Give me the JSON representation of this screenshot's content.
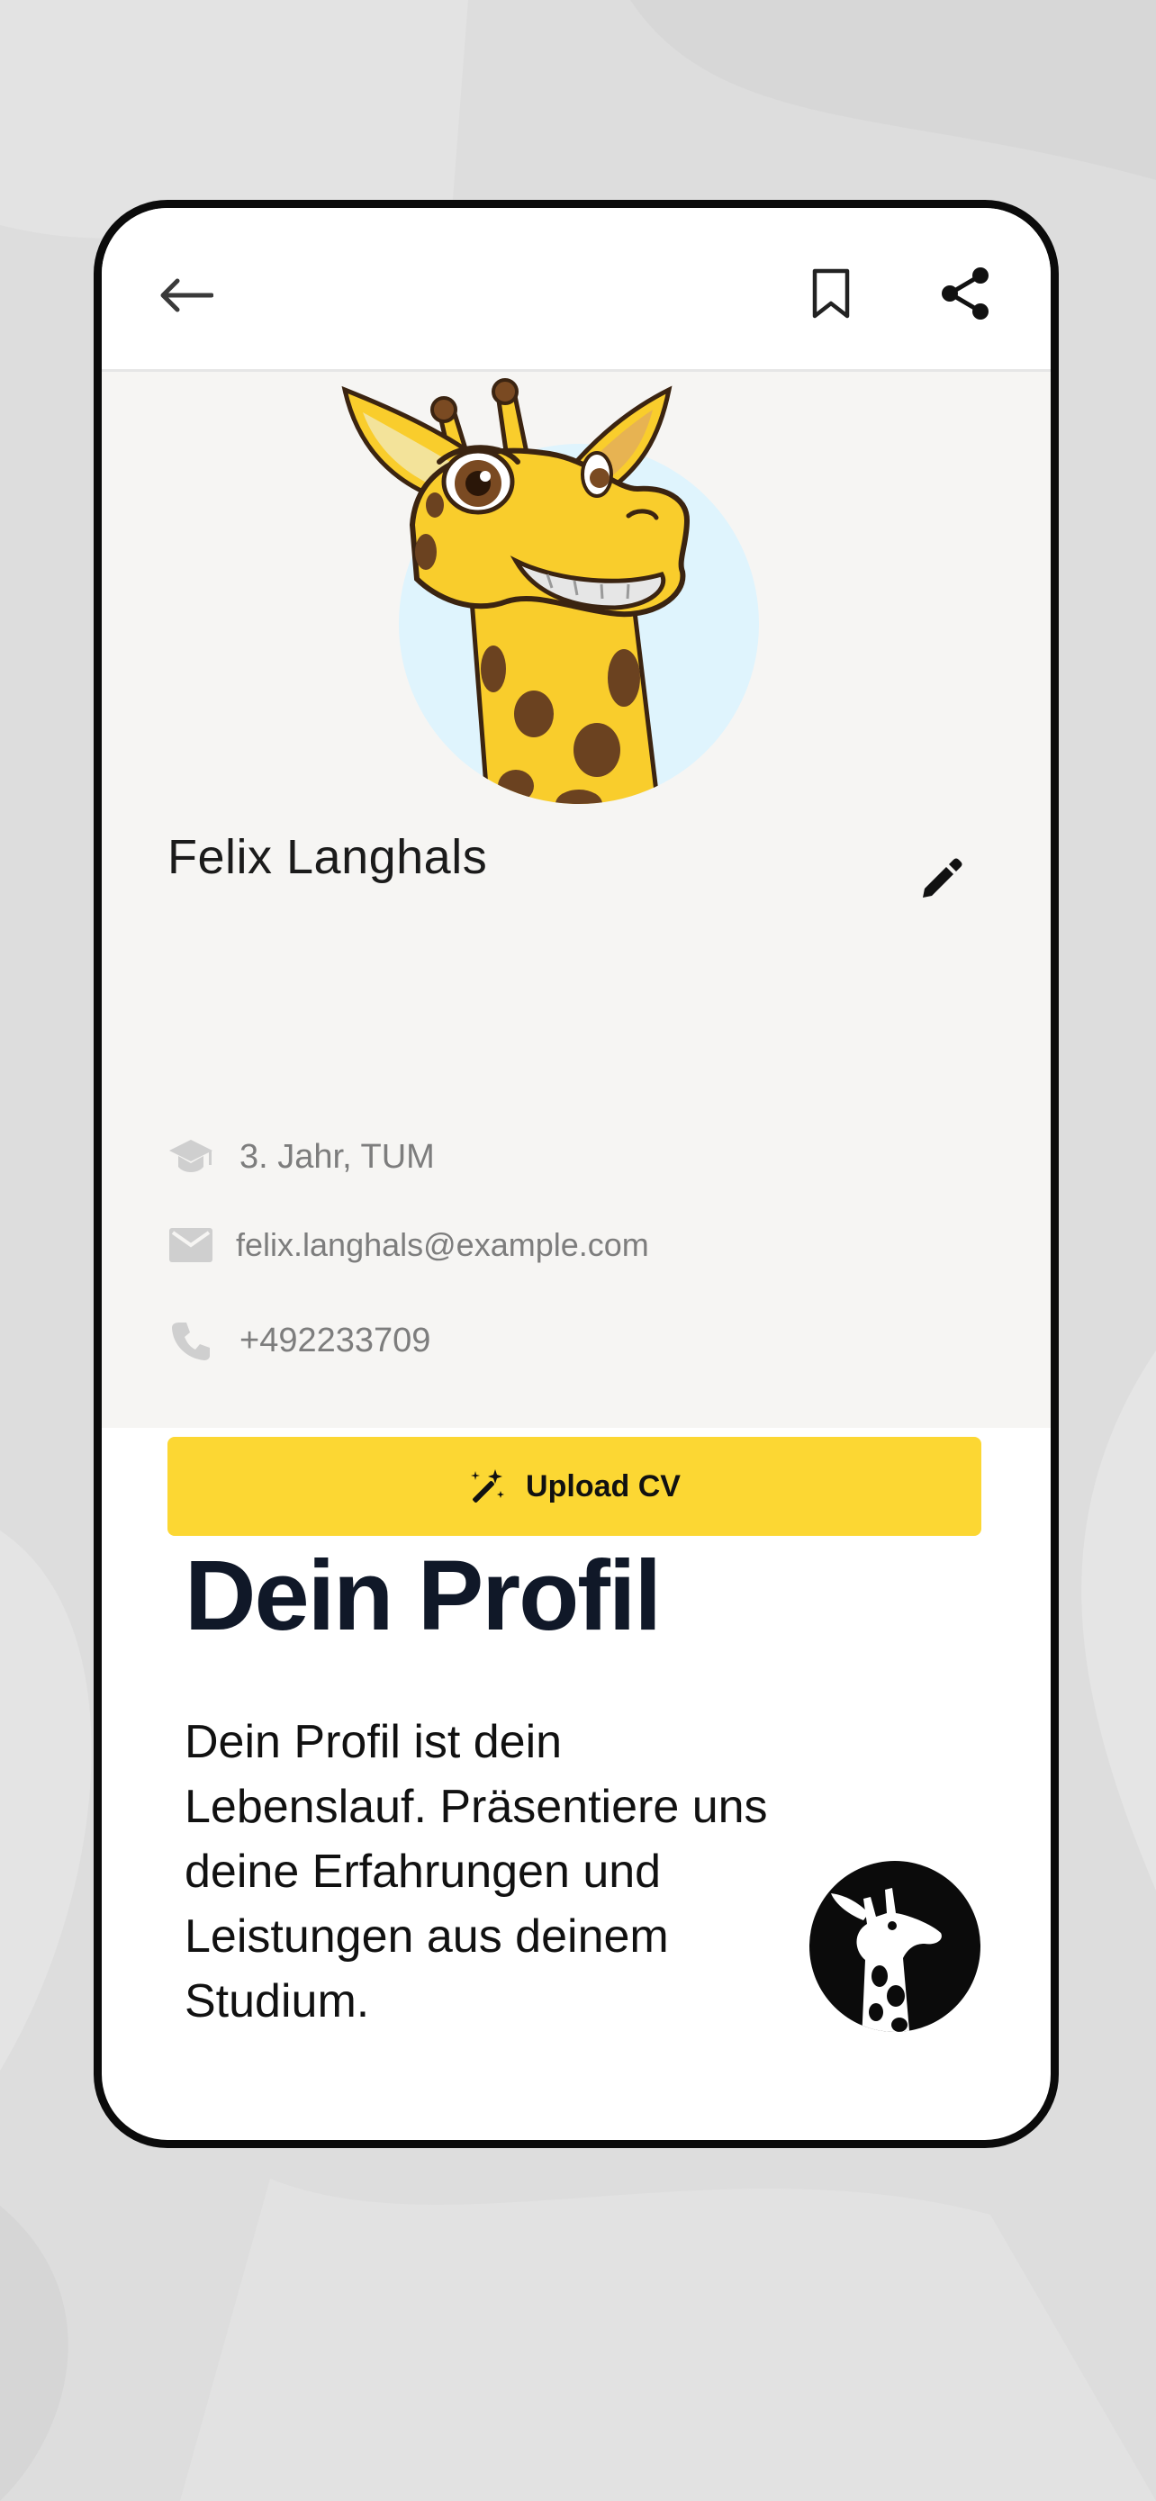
{
  "toolbar": {
    "back_icon": "arrow-left-icon",
    "bookmark_icon": "bookmark-icon",
    "share_icon": "share-icon"
  },
  "profile": {
    "name": "Felix Langhals",
    "study": "3. Jahr, TUM",
    "email": "felix.langhals@example.com",
    "phone": "+492233709",
    "upload_button": "Upload CV",
    "avatar": "giraffe-avatar"
  },
  "info": {
    "title": "Dein Profil",
    "description": "Dein Profil ist dein Lebenslauf. Präsentiere uns deine Erfahrungen und Leistungen aus deinem Studium."
  },
  "colors": {
    "accent_yellow": "#fcd733",
    "title_navy": "#101828",
    "card_background": "#f6f5f3",
    "page_background": "#dcdcdc"
  }
}
